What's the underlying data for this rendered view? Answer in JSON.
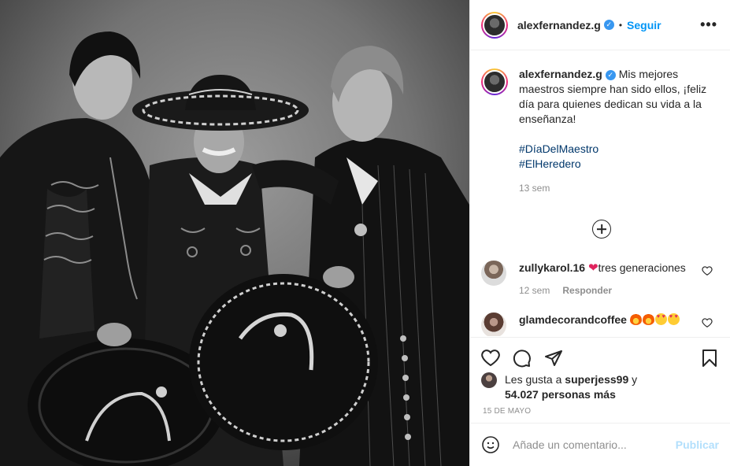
{
  "post": {
    "username": "alexfernandez.g",
    "follow_label": "Seguir",
    "separator": "•",
    "more_label": "•••",
    "verified_icon": "verified-badge-icon"
  },
  "caption": {
    "username": "alexfernandez.g",
    "text": "Mis mejores maestros siempre han sido ellos, ¡feliz día para quienes dedican su vida a la enseñanza!",
    "hashtags": [
      "#DíaDelMaestro",
      "#ElHeredero"
    ],
    "time": "13 sem"
  },
  "comments": [
    {
      "username": "zullykarol.16",
      "text": "tres generaciones",
      "time": "12 sem",
      "reply_label": "Responder"
    },
    {
      "username": "glamdecorandcoffee",
      "text": ""
    }
  ],
  "likes": {
    "prefix": "Les gusta a",
    "user": "superjess99",
    "connector": "y",
    "count": "54.027",
    "suffix": "personas más"
  },
  "date": "15 DE MAYO",
  "add_comment": {
    "placeholder": "Añade un comentario...",
    "publish_label": "Publicar"
  },
  "colors": {
    "link": "#0095f6",
    "hashtag": "#00376b",
    "muted": "#8e8e8e",
    "publish_disabled": "#b2dffc"
  }
}
